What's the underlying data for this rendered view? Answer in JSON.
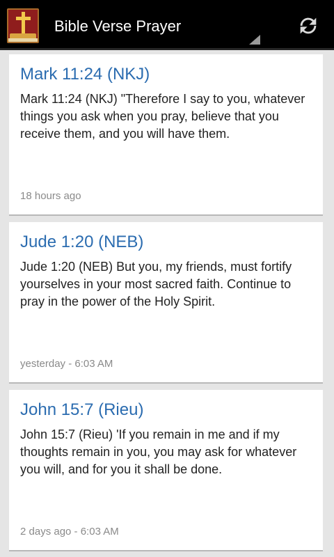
{
  "action_bar": {
    "title": "Bible Verse Prayer",
    "icons": {
      "app": "bible-app-icon",
      "refresh": "refresh-icon",
      "overflow": "spinner-caret-icon"
    },
    "colors": {
      "background": "#000000",
      "title": "#ffffff"
    }
  },
  "posts": [
    {
      "title": "Mark 11:24 (NKJ)",
      "body": "Mark 11:24 (NKJ) \"Therefore I say to you, whatever things you ask when you pray, believe that you receive them, and you will have them.",
      "time": "18 hours ago"
    },
    {
      "title": "Jude 1:20 (NEB)",
      "body": "Jude 1:20 (NEB) But you, my friends, must fortify yourselves in your most sacred faith. Continue to pray in the power of the Holy Spirit.",
      "time": "yesterday - 6:03 AM"
    },
    {
      "title": "John 15:7 (Rieu)",
      "body": "John 15:7 (Rieu) 'If you remain in me and if my thoughts remain in you, you may ask for whatever you will, and for you it shall be done.",
      "time": "2 days ago - 6:03 AM"
    }
  ],
  "colors": {
    "card_title": "#2b6cb0",
    "card_text": "#222222",
    "timestamp": "#8a8a8a",
    "page_background": "#e5e5e5"
  }
}
